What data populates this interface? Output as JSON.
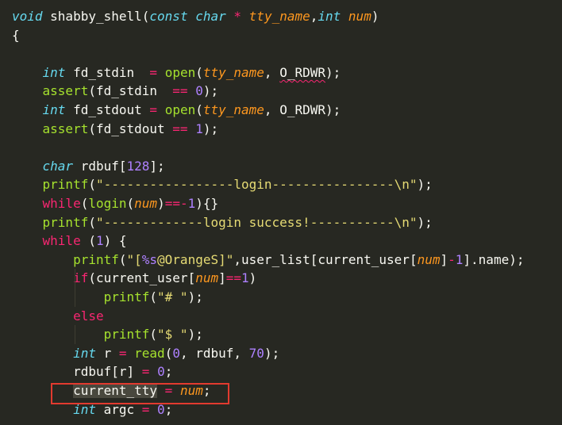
{
  "editor": {
    "language": "c",
    "theme_colors": {
      "background": "#272822",
      "keyword": "#66d9ef",
      "control": "#f92672",
      "function": "#a6e22e",
      "number": "#ae81ff",
      "string": "#e6db74",
      "parameter": "#fd971f",
      "highlight_box": "#e23a2f"
    },
    "lines": [
      {
        "i": 0,
        "tokens": [
          [
            "kw",
            "void"
          ],
          [
            "id",
            " shabby_shell"
          ],
          [
            "pu",
            "("
          ],
          [
            "kw",
            "const"
          ],
          [
            "id",
            " "
          ],
          [
            "kw",
            "char"
          ],
          [
            "id",
            " "
          ],
          [
            "op",
            "*"
          ],
          [
            "id",
            " "
          ],
          [
            "prm",
            "tty_name"
          ],
          [
            "pu",
            ","
          ],
          [
            "kw",
            "int"
          ],
          [
            "id",
            " "
          ],
          [
            "prm",
            "num"
          ],
          [
            "pu",
            ")"
          ]
        ]
      },
      {
        "i": 1,
        "tokens": [
          [
            "pu",
            "{"
          ]
        ]
      },
      {
        "i": 3,
        "tokens": [
          [
            "id",
            "    "
          ],
          [
            "kw",
            "int"
          ],
          [
            "id",
            " fd_stdin  "
          ],
          [
            "op",
            "="
          ],
          [
            "id",
            " "
          ],
          [
            "fn",
            "open"
          ],
          [
            "pu",
            "("
          ],
          [
            "prm",
            "tty_name"
          ],
          [
            "pu",
            ", "
          ],
          [
            "sq",
            "O_RDWR"
          ],
          [
            "pu",
            ");"
          ]
        ]
      },
      {
        "i": 4,
        "tokens": [
          [
            "id",
            "    "
          ],
          [
            "fn",
            "assert"
          ],
          [
            "pu",
            "("
          ],
          [
            "id",
            "fd_stdin  "
          ],
          [
            "op",
            "=="
          ],
          [
            "id",
            " "
          ],
          [
            "num",
            "0"
          ],
          [
            "pu",
            ");"
          ]
        ]
      },
      {
        "i": 5,
        "tokens": [
          [
            "id",
            "    "
          ],
          [
            "kw",
            "int"
          ],
          [
            "id",
            " fd_stdout "
          ],
          [
            "op",
            "="
          ],
          [
            "id",
            " "
          ],
          [
            "fn",
            "open"
          ],
          [
            "pu",
            "("
          ],
          [
            "prm",
            "tty_name"
          ],
          [
            "pu",
            ", "
          ],
          [
            "id",
            "O_RDWR"
          ],
          [
            "pu",
            ");"
          ]
        ]
      },
      {
        "i": 6,
        "tokens": [
          [
            "id",
            "    "
          ],
          [
            "fn",
            "assert"
          ],
          [
            "pu",
            "("
          ],
          [
            "id",
            "fd_stdout "
          ],
          [
            "op",
            "=="
          ],
          [
            "id",
            " "
          ],
          [
            "num",
            "1"
          ],
          [
            "pu",
            ");"
          ]
        ]
      },
      {
        "i": 8,
        "tokens": [
          [
            "id",
            "    "
          ],
          [
            "kw",
            "char"
          ],
          [
            "id",
            " rdbuf"
          ],
          [
            "pu",
            "["
          ],
          [
            "num",
            "128"
          ],
          [
            "pu",
            "];"
          ]
        ]
      },
      {
        "i": 9,
        "tokens": [
          [
            "id",
            "    "
          ],
          [
            "fn",
            "printf"
          ],
          [
            "pu",
            "("
          ],
          [
            "str",
            "\"-----------------login----------------\\n\""
          ],
          [
            "pu",
            ");"
          ]
        ]
      },
      {
        "i": 10,
        "tokens": [
          [
            "id",
            "    "
          ],
          [
            "ctl",
            "while"
          ],
          [
            "pu",
            "("
          ],
          [
            "fn",
            "login"
          ],
          [
            "pu",
            "("
          ],
          [
            "prm",
            "num"
          ],
          [
            "pu",
            ")"
          ],
          [
            "op",
            "=="
          ],
          [
            "op",
            "-"
          ],
          [
            "num",
            "1"
          ],
          [
            "pu",
            "){}"
          ]
        ]
      },
      {
        "i": 11,
        "tokens": [
          [
            "id",
            "    "
          ],
          [
            "fn",
            "printf"
          ],
          [
            "pu",
            "("
          ],
          [
            "str",
            "\"-------------login success!-----------\\n\""
          ],
          [
            "pu",
            ");"
          ]
        ]
      },
      {
        "i": 12,
        "tokens": [
          [
            "id",
            "    "
          ],
          [
            "ctl",
            "while"
          ],
          [
            "id",
            " "
          ],
          [
            "pu",
            "("
          ],
          [
            "num",
            "1"
          ],
          [
            "pu",
            ") {"
          ]
        ]
      },
      {
        "i": 13,
        "tokens": [
          [
            "id",
            "        "
          ],
          [
            "fn",
            "printf"
          ],
          [
            "pu",
            "("
          ],
          [
            "str",
            "\"["
          ],
          [
            "num",
            "%s"
          ],
          [
            "str",
            "@OrangeS]\""
          ],
          [
            "pu",
            ","
          ],
          [
            "id",
            "user_list"
          ],
          [
            "pu",
            "["
          ],
          [
            "id",
            "current_user"
          ],
          [
            "pu",
            "["
          ],
          [
            "prm",
            "num"
          ],
          [
            "pu",
            "]"
          ],
          [
            "op",
            "-"
          ],
          [
            "num",
            "1"
          ],
          [
            "pu",
            "]."
          ],
          [
            "id",
            "name"
          ],
          [
            "pu",
            ");"
          ]
        ]
      },
      {
        "i": 14,
        "tokens": [
          [
            "id",
            "        "
          ],
          [
            "ctl",
            "if"
          ],
          [
            "pu",
            "("
          ],
          [
            "id",
            "current_user"
          ],
          [
            "pu",
            "["
          ],
          [
            "prm",
            "num"
          ],
          [
            "pu",
            "]"
          ],
          [
            "op",
            "=="
          ],
          [
            "num",
            "1"
          ],
          [
            "pu",
            ")"
          ]
        ]
      },
      {
        "i": 15,
        "tokens": [
          [
            "id",
            "            "
          ],
          [
            "fn",
            "printf"
          ],
          [
            "pu",
            "("
          ],
          [
            "str",
            "\"# \""
          ],
          [
            "pu",
            ");"
          ]
        ]
      },
      {
        "i": 16,
        "tokens": [
          [
            "id",
            "        "
          ],
          [
            "ctl",
            "else"
          ]
        ]
      },
      {
        "i": 17,
        "tokens": [
          [
            "id",
            "            "
          ],
          [
            "fn",
            "printf"
          ],
          [
            "pu",
            "("
          ],
          [
            "str",
            "\"$ \""
          ],
          [
            "pu",
            ");"
          ]
        ]
      },
      {
        "i": 18,
        "tokens": [
          [
            "id",
            "        "
          ],
          [
            "kw",
            "int"
          ],
          [
            "id",
            " r "
          ],
          [
            "op",
            "="
          ],
          [
            "id",
            " "
          ],
          [
            "fn",
            "read"
          ],
          [
            "pu",
            "("
          ],
          [
            "num",
            "0"
          ],
          [
            "pu",
            ", "
          ],
          [
            "id",
            "rdbuf"
          ],
          [
            "pu",
            ", "
          ],
          [
            "num",
            "70"
          ],
          [
            "pu",
            ");"
          ]
        ]
      },
      {
        "i": 19,
        "tokens": [
          [
            "id",
            "        rdbuf"
          ],
          [
            "pu",
            "["
          ],
          [
            "id",
            "r"
          ],
          [
            "pu",
            "]"
          ],
          [
            "id",
            " "
          ],
          [
            "op",
            "="
          ],
          [
            "id",
            " "
          ],
          [
            "num",
            "0"
          ],
          [
            "pu",
            ";"
          ]
        ]
      },
      {
        "i": 20,
        "tokens": [
          [
            "id",
            "        "
          ],
          [
            "sel",
            "current_tty"
          ],
          [
            "id",
            " "
          ],
          [
            "op",
            "="
          ],
          [
            "id",
            " "
          ],
          [
            "prm",
            "num"
          ],
          [
            "pu",
            ";"
          ]
        ]
      },
      {
        "i": 21,
        "tokens": [
          [
            "id",
            "        "
          ],
          [
            "kw",
            "int"
          ],
          [
            "id",
            " argc "
          ],
          [
            "op",
            "="
          ],
          [
            "id",
            " "
          ],
          [
            "num",
            "0"
          ],
          [
            "pu",
            ";"
          ]
        ]
      }
    ]
  }
}
